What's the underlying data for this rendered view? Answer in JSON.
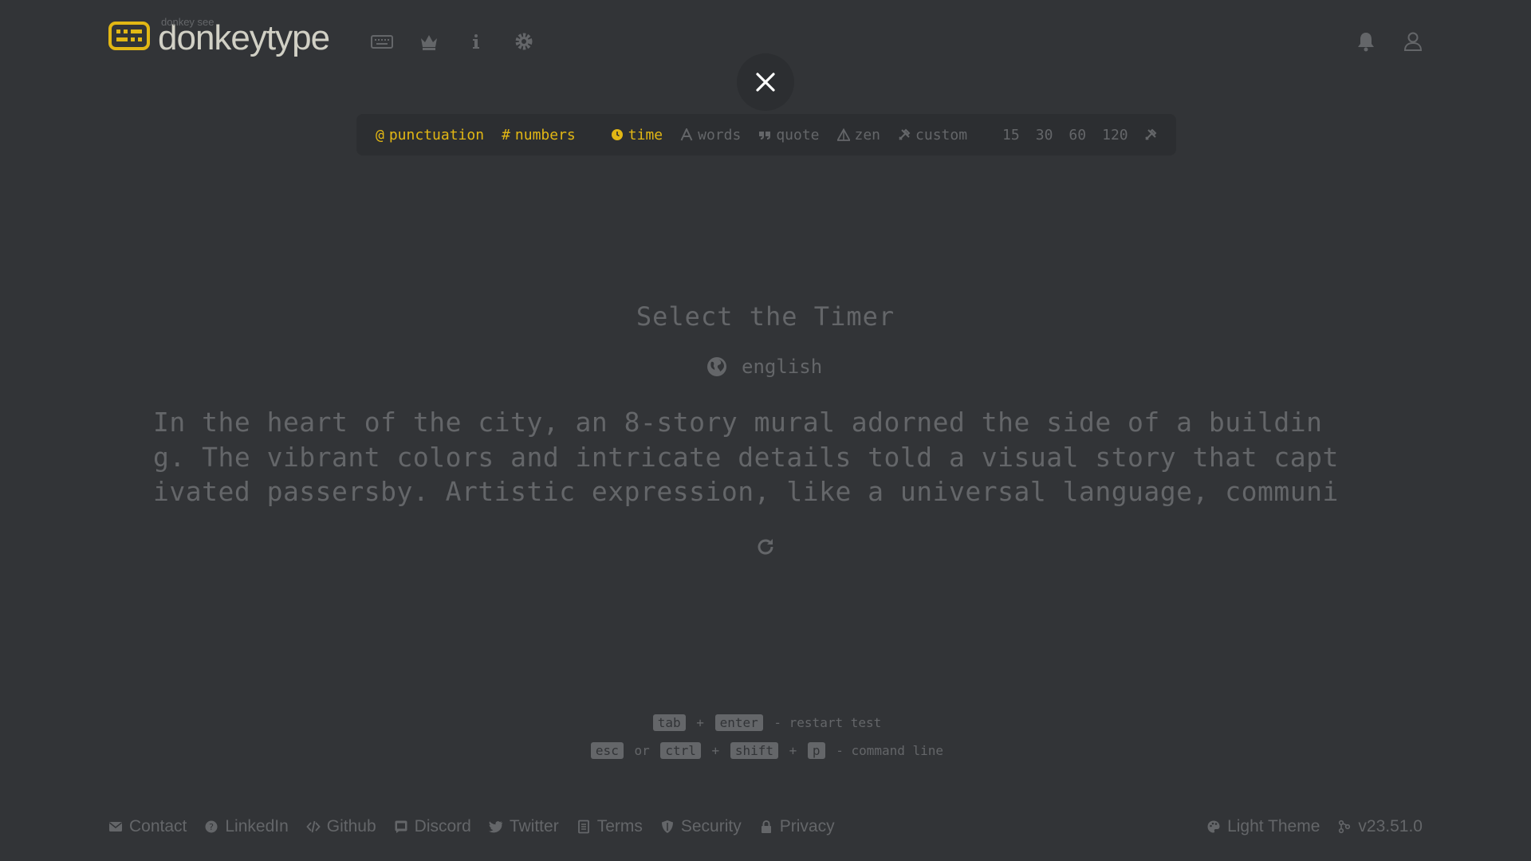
{
  "header": {
    "logo_top": "donkey see",
    "logo_text": "donkeytype",
    "nav_icons": [
      "keyboard-icon",
      "crown-icon",
      "info-icon",
      "settings-icon"
    ],
    "right_icons": [
      "bell-icon",
      "user-icon"
    ]
  },
  "config": {
    "punctuation": "punctuation",
    "numbers": "numbers",
    "time": "time",
    "words": "words",
    "quote": "quote",
    "zen": "zen",
    "custom": "custom",
    "durations": [
      "15",
      "30",
      "60",
      "120"
    ]
  },
  "main": {
    "title": "Select the Timer",
    "language": "english",
    "lines": [
      "In the heart of the city, an 8-story mural adorned the side of a buildin",
      "g. The vibrant colors and intricate details told a visual story that capt",
      "ivated passersby. Artistic expression, like a universal language, communi"
    ]
  },
  "hints": {
    "k_tab": "tab",
    "plus1": "+",
    "k_enter": "enter",
    "restart": "- restart test",
    "k_esc": "esc",
    "or": "or",
    "k_ctrl": "ctrl",
    "plus2": "+",
    "k_shift": "shift",
    "plus3": "+",
    "k_p": "p",
    "cmd": "- command line"
  },
  "footer": {
    "contact": "Contact",
    "linkedin": "LinkedIn",
    "github": "Github",
    "discord": "Discord",
    "twitter": "Twitter",
    "terms": "Terms",
    "security": "Security",
    "privacy": "Privacy",
    "theme": "Light Theme",
    "version": "v23.51.0"
  },
  "colors": {
    "bg": "#323437",
    "sub": "#646669",
    "main": "#e2b714",
    "text": "#d1d0c5",
    "sub_alt": "#2c2e31"
  }
}
